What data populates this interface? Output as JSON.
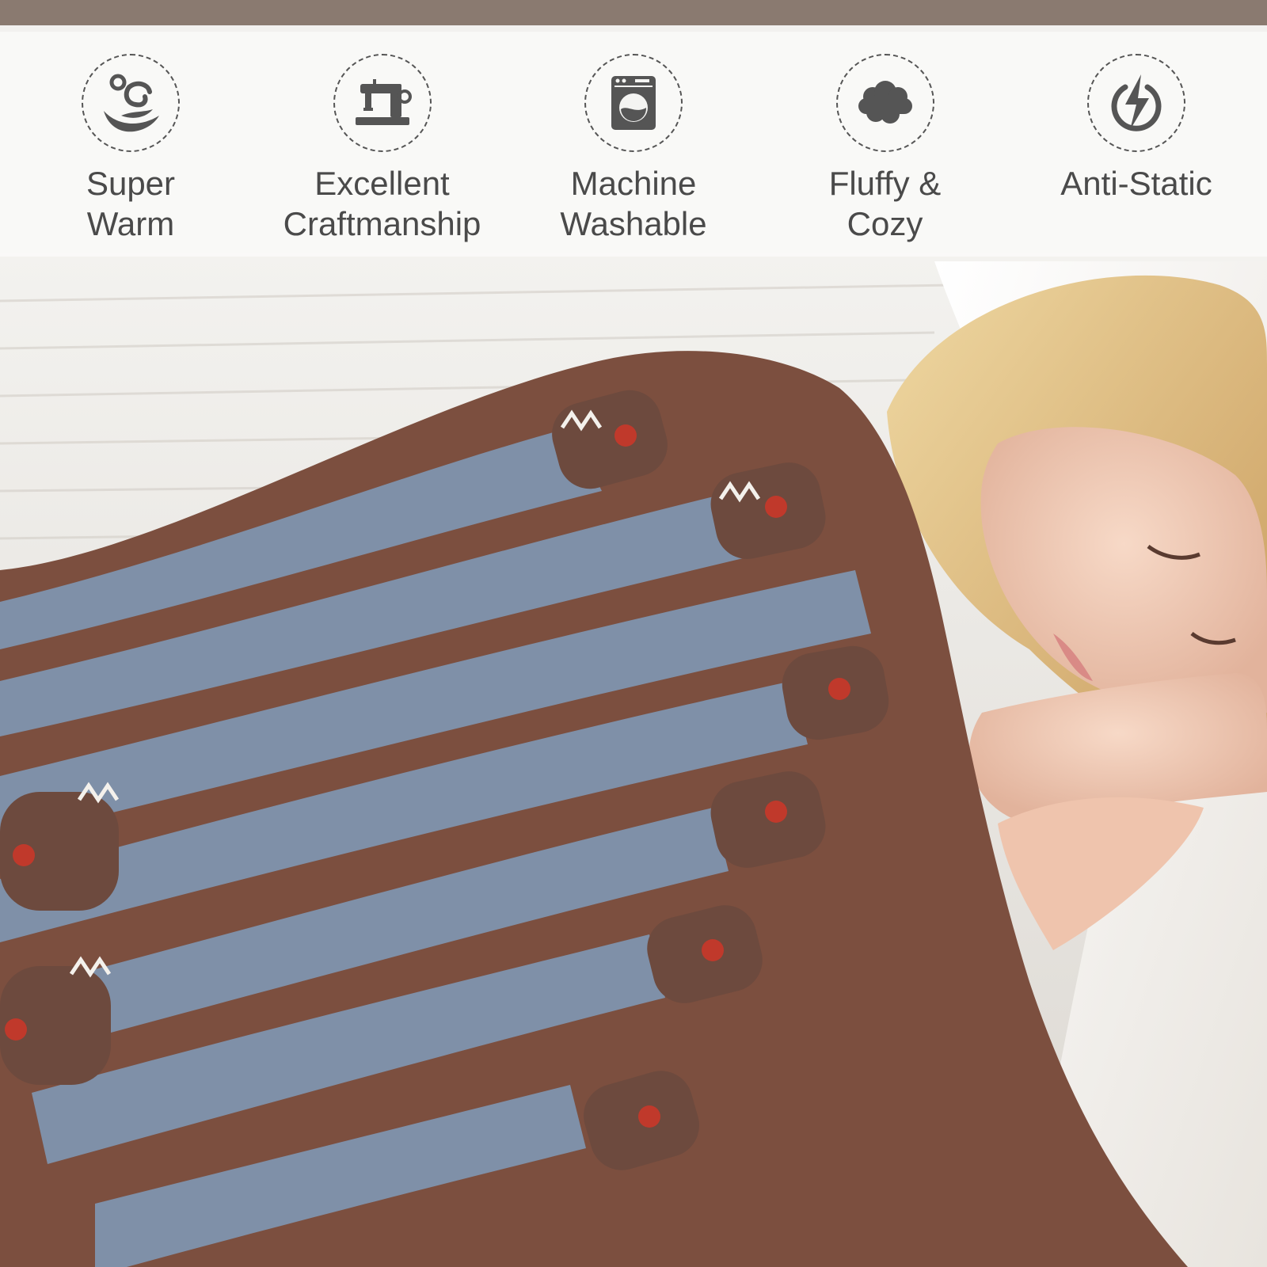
{
  "banner": {
    "features": [
      {
        "icon": "warm-hand-icon",
        "label": "Super Warm"
      },
      {
        "icon": "sewing-machine-icon",
        "label": "Excellent\nCraftmanship"
      },
      {
        "icon": "washing-machine-icon",
        "label": "Machine\nWashable"
      },
      {
        "icon": "cloud-icon",
        "label": "Fluffy & Cozy"
      },
      {
        "icon": "lightning-bolt-icon",
        "label": "Anti-Static"
      }
    ]
  },
  "colors": {
    "banner_background": "#f9f9f8",
    "icon": "#555555",
    "label": "#4a4a4a",
    "blanket_blue": "#7d8ea6",
    "blanket_brown": "#7a4e3e",
    "hair": "#e8c98a",
    "skin": "#f2cdb8"
  }
}
